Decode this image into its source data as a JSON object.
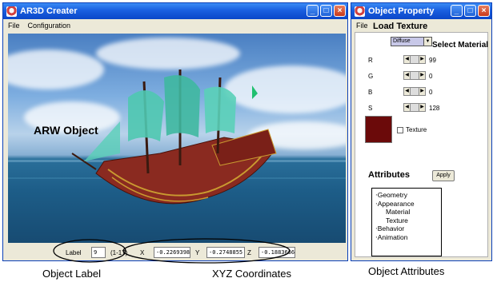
{
  "main_window": {
    "title": "AR3D Creater",
    "menu": [
      "File",
      "Configuration"
    ],
    "status": {
      "label_text": "Label",
      "label_value": "9",
      "label_range": "(1-17)",
      "x_label": "X",
      "x_value": "-0.2269398",
      "y_label": "Y",
      "y_value": "-0.2748855",
      "z_label": "Z",
      "z_value": "-0.1883666"
    }
  },
  "property_window": {
    "title": "Object Property",
    "menu_file": "File",
    "material_selected": "Diffuse",
    "channels": [
      {
        "name": "R",
        "value": "99"
      },
      {
        "name": "G",
        "value": "0"
      },
      {
        "name": "B",
        "value": "0"
      },
      {
        "name": "S",
        "value": "128"
      }
    ],
    "swatch_color": "#6b0a0a",
    "texture_label": "Texture",
    "attributes_heading": "Attributes",
    "apply_label": "Apply",
    "attributes": [
      "‧Geometry",
      "‧Appearance",
      "Material",
      "Texture",
      "‧Behavior",
      "‧Animation"
    ]
  },
  "annotations": {
    "load_texture": "Load Texture",
    "select_material": "Select Material",
    "arw_object": "ARW Object",
    "object_label": "Object Label",
    "xyz_coordinates": "XYZ Coordinates",
    "object_attributes": "Object Attributes"
  },
  "colors": {
    "titlebar_blue": "#1a5fe0",
    "ship_hull": "#8a2a20",
    "sails": "#4fc8b0"
  }
}
